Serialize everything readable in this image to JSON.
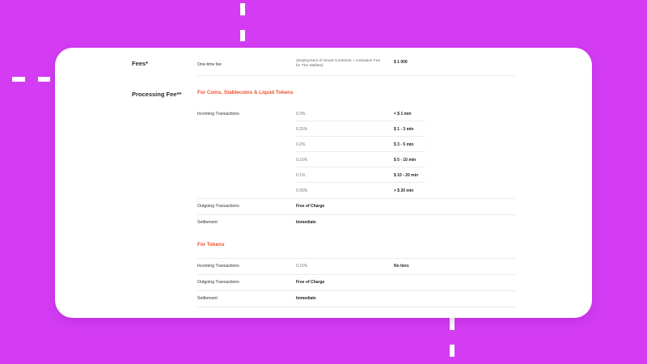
{
  "fees": {
    "heading": "Fees*",
    "item": "One-time fee",
    "note": "(Deployment of Smart Contracts + Activation Fee for The Wallets)",
    "value": "$ 1 000"
  },
  "processing": {
    "heading": "Processing Fee**",
    "coins": {
      "title": "For Coins,  Stablecoins & Liquid Tokens",
      "incoming_label": "Incoming Transactions",
      "tiers": [
        {
          "rate": "0.3%",
          "range": "< $ 1 min"
        },
        {
          "rate": "0.25%",
          "range": "$ 1 - 3 min"
        },
        {
          "rate": "0.2%",
          "range": "$ 3 - 5 min"
        },
        {
          "rate": "0.15%",
          "range": "$ 5 - 10 min"
        },
        {
          "rate": "0.1%",
          "range": "$ 10 - 20 min"
        },
        {
          "rate": "0.05%",
          "range": "> $ 20 min"
        }
      ],
      "outgoing_label": "Outgoing Transactions",
      "outgoing_value": "Free of Charge",
      "settlement_label": "Settlement",
      "settlement_value": "Immediate"
    },
    "tokens": {
      "title": "For Tokens",
      "incoming_label": "Incoming Transactions",
      "incoming_rate": "0.15%",
      "incoming_tiers": "No tiers",
      "outgoing_label": "Outgoing Transactions",
      "outgoing_value": "Free of Charge",
      "settlement_label": "Settlement",
      "settlement_value": "Immediate"
    }
  },
  "colors": {
    "background": "#d43cf4",
    "accent": "#ee4f2b",
    "card": "#ffffff"
  }
}
